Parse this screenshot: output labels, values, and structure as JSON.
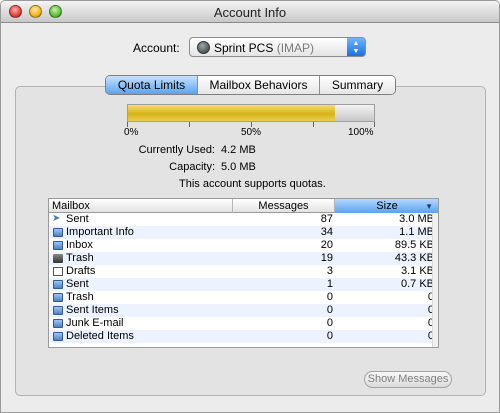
{
  "window": {
    "title": "Account Info"
  },
  "account": {
    "label": "Account:",
    "name": "Sprint PCS",
    "type": "(IMAP)"
  },
  "tabs": [
    {
      "label": "Quota Limits",
      "active": true
    },
    {
      "label": "Mailbox Behaviors",
      "active": false
    },
    {
      "label": "Summary",
      "active": false
    }
  ],
  "quota": {
    "usage_fraction": 0.84,
    "ticks": [
      "0%",
      "50%",
      "100%"
    ],
    "currently_used_label": "Currently Used:",
    "currently_used_value": "4.2 MB",
    "capacity_label": "Capacity:",
    "capacity_value": "5.0 MB",
    "supports_note": "This account supports quotas."
  },
  "table": {
    "columns": [
      "Mailbox",
      "Messages",
      "Size"
    ],
    "sorted_column": "Size",
    "rows": [
      {
        "icon": "sent-icon",
        "name": "Sent",
        "messages": "87",
        "size": "3.0 MB"
      },
      {
        "icon": "folder-icon",
        "name": "Important Info",
        "messages": "34",
        "size": "1.1 MB"
      },
      {
        "icon": "folder-icon",
        "name": "Inbox",
        "messages": "20",
        "size": "89.5 KB"
      },
      {
        "icon": "trash-icon",
        "name": "Trash",
        "messages": "19",
        "size": "43.3 KB"
      },
      {
        "icon": "document-icon",
        "name": "Drafts",
        "messages": "3",
        "size": "3.1 KB"
      },
      {
        "icon": "folder-icon",
        "name": "Sent",
        "messages": "1",
        "size": "0.7 KB"
      },
      {
        "icon": "folder-icon",
        "name": "Trash",
        "messages": "0",
        "size": "0"
      },
      {
        "icon": "folder-icon",
        "name": "Sent Items",
        "messages": "0",
        "size": "0"
      },
      {
        "icon": "folder-icon",
        "name": "Junk E-mail",
        "messages": "0",
        "size": "0"
      },
      {
        "icon": "folder-icon",
        "name": "Deleted Items",
        "messages": "0",
        "size": "0"
      }
    ]
  },
  "show_messages_button": {
    "label": "Show Messages",
    "enabled": false
  }
}
